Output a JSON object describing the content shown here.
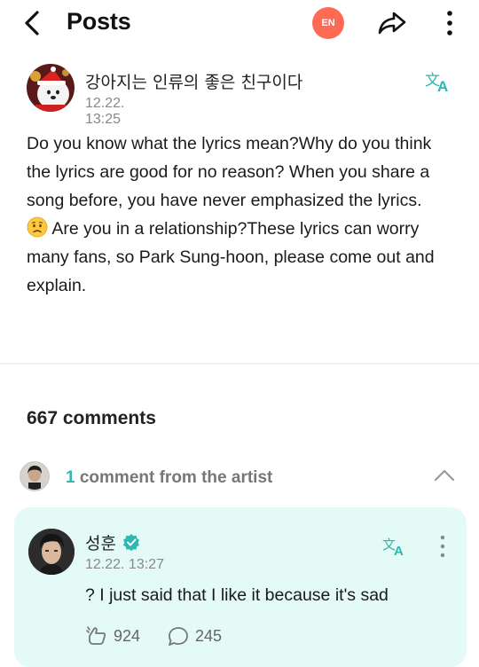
{
  "header": {
    "title": "Posts",
    "language_badge": "EN"
  },
  "post": {
    "author": "강아지는 인류의 좋은 친구이다",
    "timestamp": "12.22. 13:25",
    "body_part1": "Do you know what the lyrics mean?Why do you think the lyrics are good for no reason? When you share a song before, you have never emphasized the lyrics. ",
    "body_part2": " Are you in a relationship?These lyrics can worry many fans, so Park Sung-hoon, please come out and explain."
  },
  "comments": {
    "count_label": "667 comments",
    "artist_count": "1",
    "artist_label": "comment from the artist"
  },
  "artist_comment": {
    "author": "성훈",
    "timestamp": "12.22. 13:27",
    "text": "? I just said that I like it because it's sad",
    "likes": "924",
    "replies": "245"
  },
  "colors": {
    "accent": "#2fb7b0",
    "card_bg": "#e3faf6",
    "badge": "#ff6a55"
  }
}
